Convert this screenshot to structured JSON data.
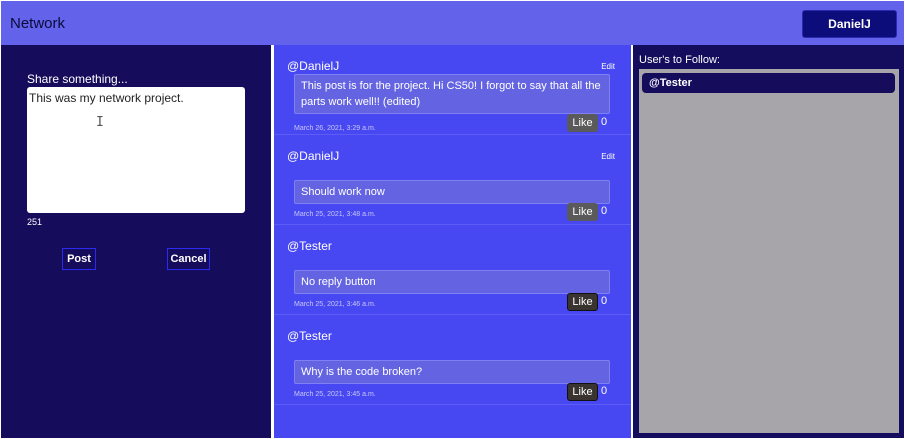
{
  "header": {
    "brand": "Network",
    "user_button": "DanielJ"
  },
  "composer": {
    "label": "Share something...",
    "text": "This was my network project.",
    "char_count": "251",
    "post_label": "Post",
    "cancel_label": "Cancel"
  },
  "posts": [
    {
      "author": "@DanielJ",
      "edit": "Edit",
      "content": "This post is for the project. Hi CS50! I forgot to say that all the parts work well!! (edited)",
      "date": "March 26, 2021, 3:29 a.m.",
      "like_label": "Like",
      "likes": "0"
    },
    {
      "author": "@DanielJ",
      "edit": "Edit",
      "content": "Should work now",
      "date": "March 25, 2021, 3:48 a.m.",
      "like_label": "Like",
      "likes": "0"
    },
    {
      "author": "@Tester",
      "content": "No reply button",
      "date": "March 25, 2021, 3:46 a.m.",
      "like_label": "Like",
      "likes": "0"
    },
    {
      "author": "@Tester",
      "content": "Why is the code broken?",
      "date": "March 25, 2021, 3:45 a.m.",
      "like_label": "Like",
      "likes": "0"
    }
  ],
  "follow_panel": {
    "label": "User's to Follow:",
    "users": [
      "@Tester"
    ]
  },
  "icons": {
    "text_cursor": "text-cursor-icon"
  },
  "colors": {
    "header_bg": "#6262ea",
    "left_bg": "#150c5c",
    "feed_bg": "#4848f2",
    "follow_bg": "#a7a5aa"
  }
}
